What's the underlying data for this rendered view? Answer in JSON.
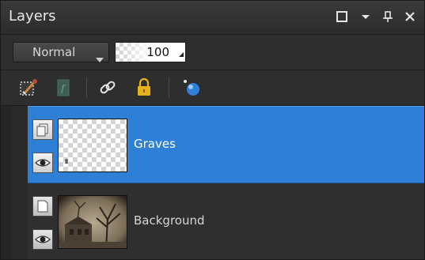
{
  "panel": {
    "title": "Layers"
  },
  "titlebar_buttons": [
    {
      "name": "maximize-icon"
    },
    {
      "name": "menu-dropdown-icon"
    },
    {
      "name": "pin-icon"
    },
    {
      "name": "close-icon"
    }
  ],
  "blend": {
    "mode": "Normal",
    "opacity": "100"
  },
  "toolbar": {
    "tools": [
      "new-mask-icon",
      "new-adjustment-layer-icon",
      "link-icon",
      "lock-icon",
      "layer-styles-icon"
    ]
  },
  "layers": [
    {
      "name": "Graves",
      "selected": true
    },
    {
      "name": "Background",
      "selected": false
    }
  ],
  "colors": {
    "selection": "#2e7fd6",
    "panel_bg": "#262626",
    "lock": "#e8b11c",
    "effects": "#2f7fd9"
  }
}
